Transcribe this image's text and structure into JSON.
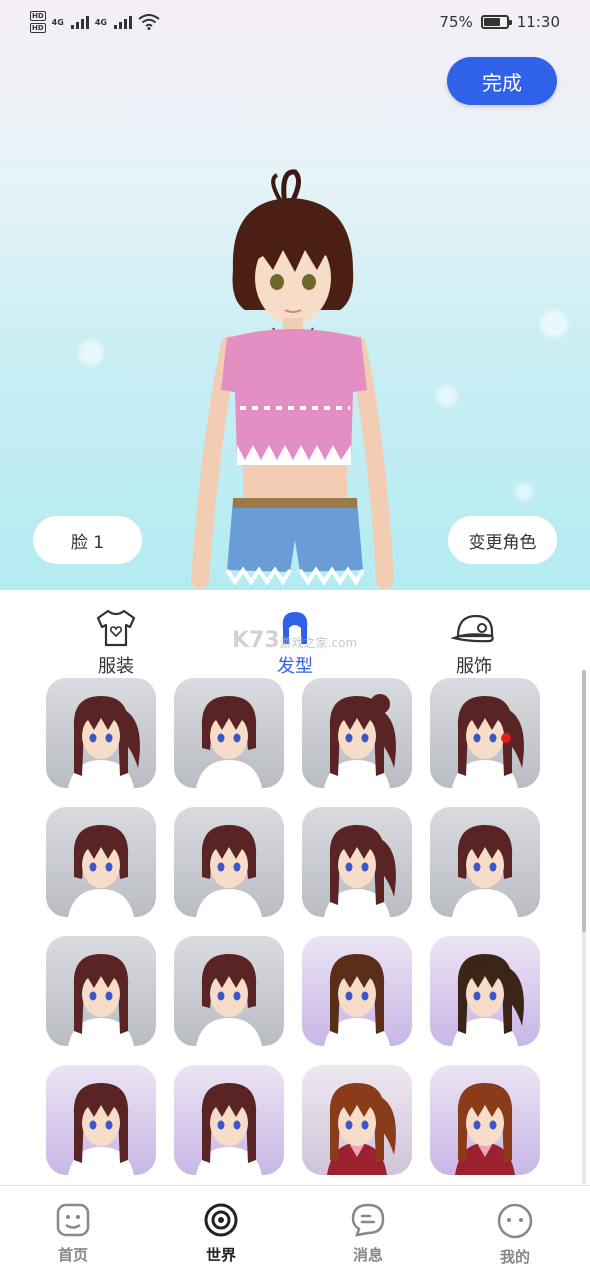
{
  "status_bar": {
    "network_1": "4G",
    "network_2": "4G",
    "hd_1": "HD",
    "hd_2": "HD",
    "battery_percent": "75%",
    "battery_level": 0.75,
    "time": "11:30"
  },
  "scene": {
    "done_label": "完成",
    "face_label": "脸 1",
    "change_role_label": "变更角色"
  },
  "categories": [
    {
      "label": "服装",
      "icon": "tshirt-icon",
      "active": false
    },
    {
      "label": "发型",
      "icon": "hair-icon",
      "active": true
    },
    {
      "label": "服饰",
      "icon": "cap-icon",
      "active": false
    }
  ],
  "watermark": {
    "brand": "K73",
    "text": "游戏之家",
    "domain": ".com"
  },
  "hair_tiles": [
    {
      "style": "side-ponytail",
      "bg": "gray",
      "hair": "#5a2424"
    },
    {
      "style": "short-bob",
      "bg": "gray",
      "hair": "#5a2424"
    },
    {
      "style": "twin-buns",
      "bg": "gray",
      "hair": "#5a2424"
    },
    {
      "style": "low-ponytail-bow",
      "bg": "gray",
      "hair": "#5a2424"
    },
    {
      "style": "medium",
      "bg": "gray",
      "hair": "#5a2424"
    },
    {
      "style": "bob-bangs",
      "bg": "gray",
      "hair": "#5a2424"
    },
    {
      "style": "high-ponytail",
      "bg": "gray",
      "hair": "#5a2424"
    },
    {
      "style": "medium-waves",
      "bg": "gray",
      "hair": "#5a2424"
    },
    {
      "style": "straight",
      "bg": "gray",
      "hair": "#5a2424"
    },
    {
      "style": "layered",
      "bg": "gray",
      "hair": "#5a2424"
    },
    {
      "style": "long-straight",
      "bg": "lavender",
      "hair": "#5b2e1a"
    },
    {
      "style": "long-ponytail",
      "bg": "lavender",
      "hair": "#3b2418"
    },
    {
      "style": "hime",
      "bg": "lavender",
      "hair": "#5a2424"
    },
    {
      "style": "long-side",
      "bg": "lavender",
      "hair": "#5a2424"
    },
    {
      "style": "twin-tails-uniform",
      "bg": "room",
      "hair": "#8a3b1a"
    },
    {
      "style": "long-uniform",
      "bg": "lavender",
      "hair": "#8a3b1a"
    }
  ],
  "bottom_nav": [
    {
      "label": "首页",
      "icon": "home-face-icon",
      "active": false
    },
    {
      "label": "世界",
      "icon": "world-target-icon",
      "active": true
    },
    {
      "label": "消息",
      "icon": "message-icon",
      "active": false
    },
    {
      "label": "我的",
      "icon": "profile-face-icon",
      "active": false
    }
  ],
  "colors": {
    "accent": "#2f62e8",
    "sky_top": "#f6eef6",
    "sky_bottom": "#b4ecf2"
  }
}
